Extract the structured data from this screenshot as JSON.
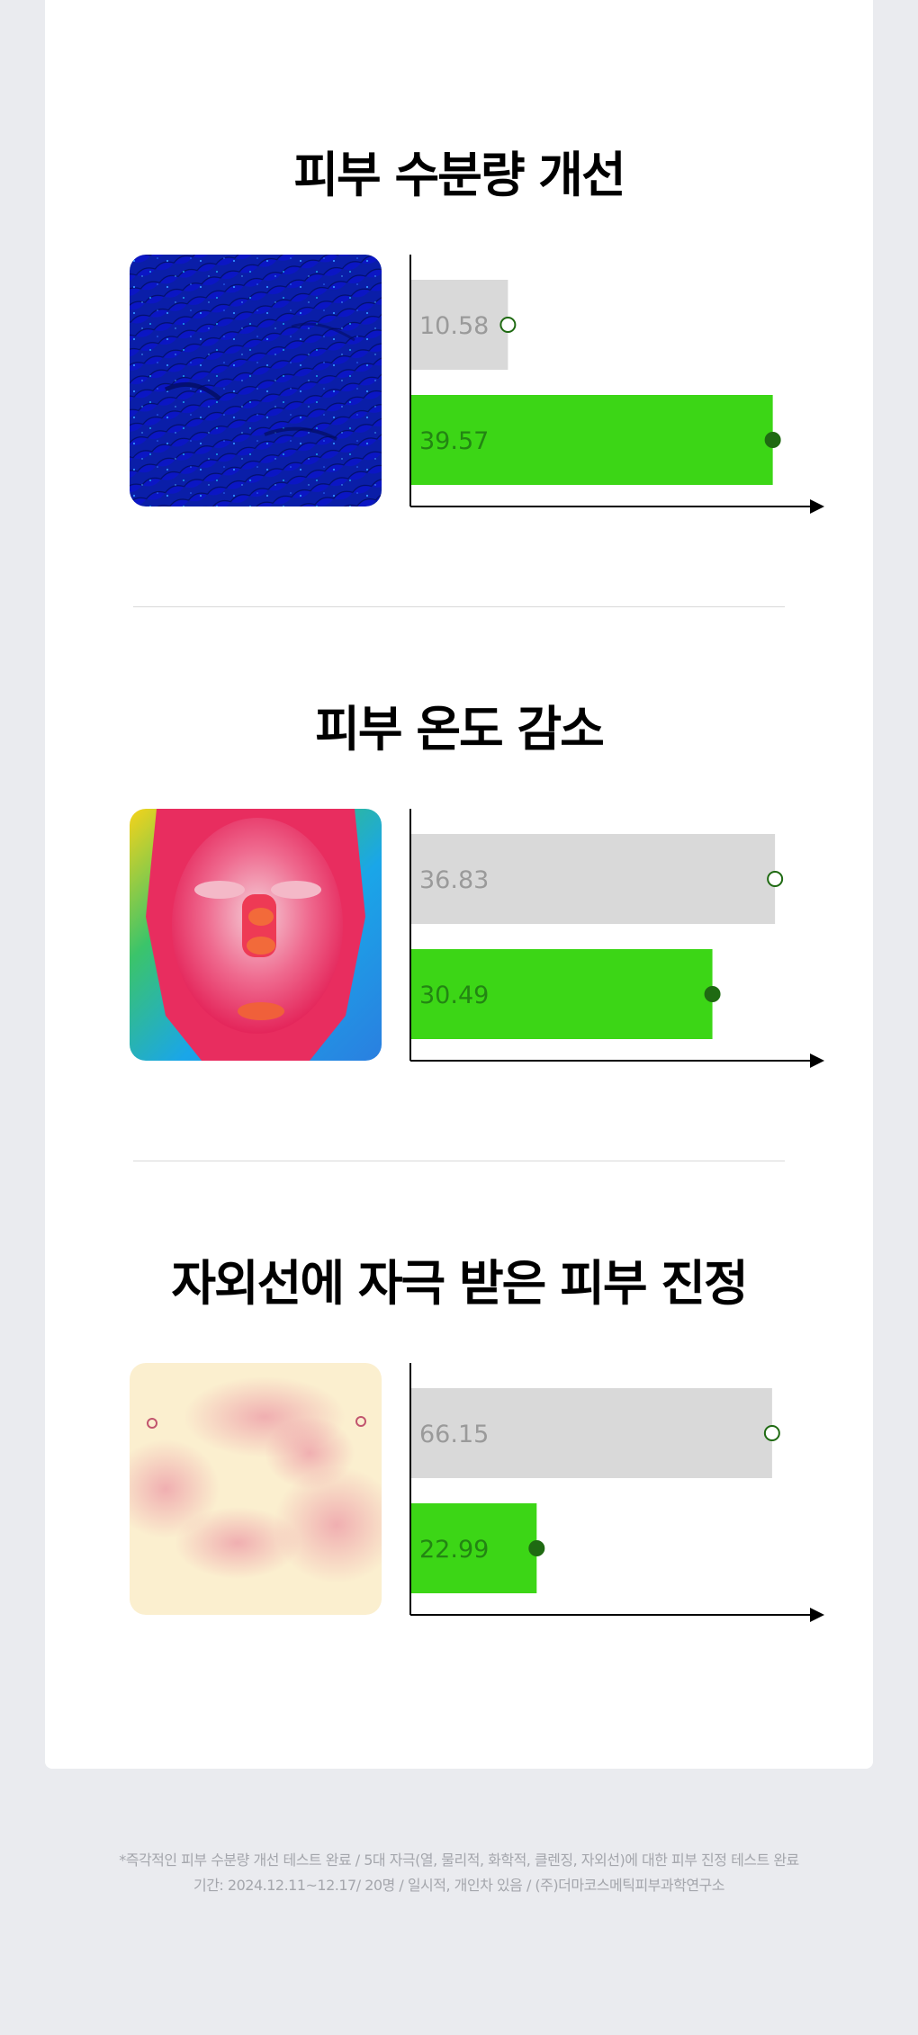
{
  "sections": [
    {
      "title": "피부 수분량 개선",
      "image_icon": "skin-moisture-scan-image",
      "chart_data": {
        "type": "bar",
        "orientation": "horizontal",
        "values": [
          10.58,
          39.57
        ],
        "xlim": [
          0,
          40
        ],
        "colors": [
          "#d9d9d9",
          "#3cd616"
        ],
        "label_colors": [
          "#9a9a9a",
          "#238513"
        ],
        "markers": [
          "hollow",
          "filled"
        ]
      }
    },
    {
      "title": "피부 온도 감소",
      "image_icon": "thermal-face-image",
      "chart_data": {
        "type": "bar",
        "orientation": "horizontal",
        "values": [
          36.83,
          30.49
        ],
        "xlim": [
          0,
          37
        ],
        "colors": [
          "#d9d9d9",
          "#3cd616"
        ],
        "label_colors": [
          "#9a9a9a",
          "#238513"
        ],
        "markers": [
          "hollow",
          "filled"
        ]
      }
    },
    {
      "title": "자외선에 자극 받은 피부 진정",
      "image_icon": "uv-irritated-skin-image",
      "chart_data": {
        "type": "bar",
        "orientation": "horizontal",
        "values": [
          66.15,
          22.99
        ],
        "xlim": [
          0,
          67
        ],
        "colors": [
          "#d9d9d9",
          "#3cd616"
        ],
        "label_colors": [
          "#9a9a9a",
          "#238513"
        ],
        "markers": [
          "hollow",
          "filled"
        ]
      }
    }
  ],
  "footnote": {
    "line1": "*즉각적인 피부 수분량 개선 테스트 완료 / 5대 자극(열, 물리적, 화학적, 클렌징, 자외선)에 대한 피부 진정 테스트 완료",
    "line2": "기간: 2024.12.11~12.17/ 20명 / 일시적, 개인차 있음 / (주)더마코스메틱피부과학연구소"
  },
  "colors": {
    "page_bg": "#eaebef",
    "card_bg": "#ffffff",
    "accent_green": "#3cd616",
    "dark_green": "#1f6a12",
    "bar_gray": "#d9d9d9"
  }
}
